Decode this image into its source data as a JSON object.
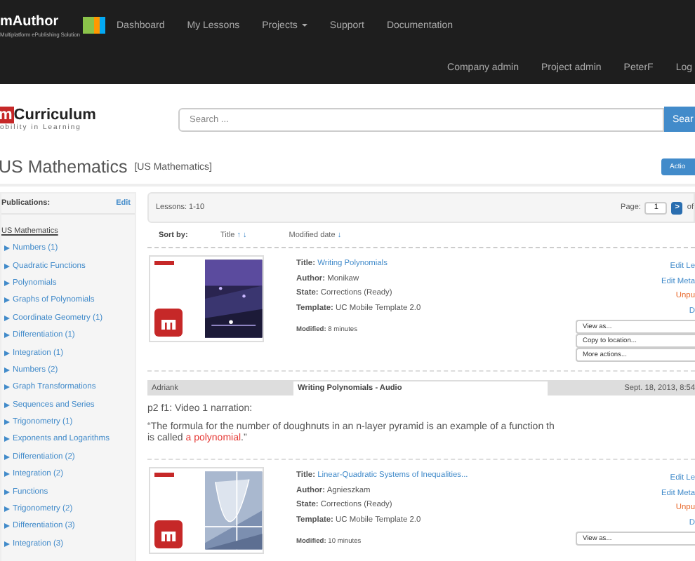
{
  "nav": {
    "logo": {
      "name": "mAuthor",
      "tagline": "Multiplatform ePublishing Solution"
    },
    "links": [
      {
        "label": "Dashboard",
        "dropdown": false
      },
      {
        "label": "My Lessons",
        "dropdown": false
      },
      {
        "label": "Projects",
        "dropdown": true
      },
      {
        "label": "Support",
        "dropdown": false
      },
      {
        "label": "Documentation",
        "dropdown": false
      }
    ],
    "admin_links": [
      "Company admin",
      "Project admin",
      "PeterF",
      "Log"
    ]
  },
  "brand": {
    "mark": "m",
    "name": "Curriculum",
    "tagline": "obility in Learning"
  },
  "search": {
    "placeholder": "Search ...",
    "button": "Sear"
  },
  "page_title": {
    "title": "US Mathematics",
    "subtitle": "[US Mathematics]",
    "action_button": "Actio"
  },
  "sidebar": {
    "heading": "Publications:",
    "edit": "Edit",
    "root": "US Mathematics",
    "items": [
      "Numbers (1)",
      "Quadratic Functions",
      "Polynomials",
      "Graphs of Polynomials",
      "Coordinate Geometry (1)",
      "Differentiation (1)",
      "Integration (1)",
      "Numbers (2)",
      "Graph Transformations",
      "Sequences and Series",
      "Trigonometry (1)",
      "Exponents and Logarithms",
      "Differentiation (2)",
      "Integration (2)",
      "Functions",
      "Trigonometry (2)",
      "Differentiation (3)",
      "Integration (3)"
    ]
  },
  "lessons_bar": {
    "count": "Lessons: 1-10",
    "page_label": "Page:",
    "page_value": "1",
    "next": ">",
    "of": "of"
  },
  "sort": {
    "label": "Sort by:",
    "options": [
      {
        "label": "Title",
        "arrows": "↑ ↓"
      },
      {
        "label": "Modified date",
        "arrows": "↓"
      }
    ]
  },
  "entries": [
    {
      "kind": "lesson",
      "fields": [
        {
          "label": "Title:",
          "value": "Writing Polynomials",
          "link": true
        },
        {
          "label": "Author:",
          "value": "Monikaw",
          "link": false
        },
        {
          "label": "State:",
          "value": "Corrections (Ready)",
          "link": false
        },
        {
          "label": "Template:",
          "value": "UC Mobile Template 2.0",
          "link": false
        }
      ],
      "modified_label": "Modified:",
      "modified": "8 minutes",
      "actions": [
        {
          "label": "Edit Le",
          "kind": "link"
        },
        {
          "label": "Edit Meta",
          "kind": "link"
        },
        {
          "label": "Unpu",
          "kind": "warning"
        },
        {
          "label": "D",
          "kind": "link"
        }
      ],
      "menus": [
        "View as...",
        "Copy to location...",
        "More actions..."
      ]
    },
    {
      "kind": "comment",
      "user": "Adriank",
      "subject": "Writing Polynomials - Audio",
      "date": "Sept. 18, 2013, 8:54",
      "heading": "p2 f1: Video 1 narration:",
      "quote_lines": [
        [
          {
            "text": "“The formula for the number of doughnuts in an n-layer pyramid is an example of a function th",
            "highlight": false
          }
        ],
        [
          {
            "text": "is called ",
            "highlight": false
          },
          {
            "text": "a polynomial",
            "highlight": true
          },
          {
            "text": ".”",
            "highlight": false
          }
        ]
      ]
    },
    {
      "kind": "lesson",
      "fields": [
        {
          "label": "Title:",
          "value": "Linear-Quadratic Systems of Inequalities...",
          "link": true
        },
        {
          "label": "Author:",
          "value": "Agnieszkam",
          "link": false
        },
        {
          "label": "State:",
          "value": "Corrections (Ready)",
          "link": false
        },
        {
          "label": "Template:",
          "value": "UC Mobile Template 2.0",
          "link": false
        }
      ],
      "modified_label": "Modified:",
      "modified": "10 minutes",
      "actions": [
        {
          "label": "Edit Le",
          "kind": "link"
        },
        {
          "label": "Edit Meta",
          "kind": "link"
        },
        {
          "label": "Unpu",
          "kind": "warning"
        },
        {
          "label": "D",
          "kind": "link"
        }
      ],
      "menus": [
        "View as..."
      ]
    }
  ]
}
